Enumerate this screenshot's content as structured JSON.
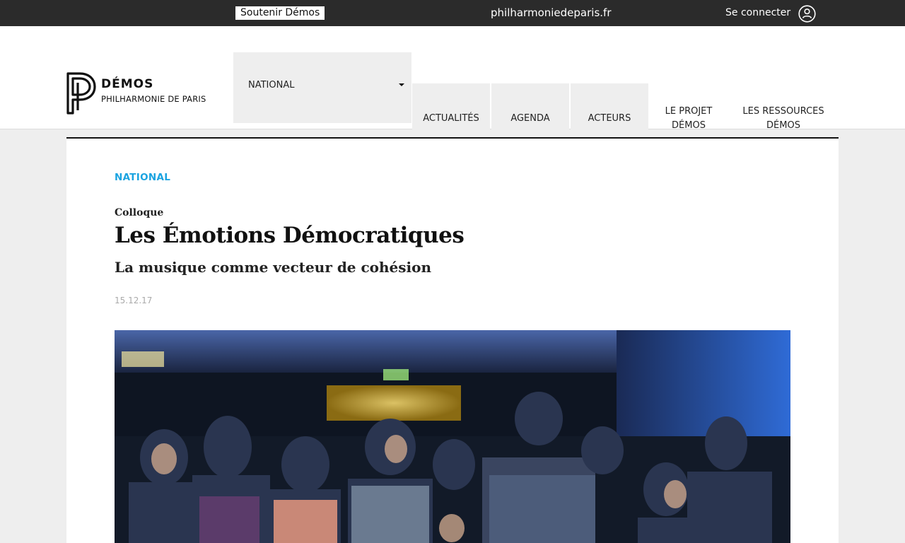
{
  "topbar": {
    "support_label": "Soutenir Démos",
    "site_link": "philharmoniedeparis.fr",
    "login_label": "Se connecter",
    "user_icon": "user-icon"
  },
  "logo": {
    "title": "DÉMOS",
    "subtitle": "PHILHARMONIE DE PARIS"
  },
  "nav": {
    "national": "NATIONAL",
    "items": [
      "ACTUALITÉS",
      "AGENDA",
      "ACTEURS"
    ],
    "projet_line1": "LE PROJET",
    "projet_line2": "DÉMOS",
    "ressources_line1": "LES RESSOURCES",
    "ressources_line2": "DÉMOS"
  },
  "article": {
    "category": "NATIONAL",
    "kicker": "Colloque",
    "title": "Les Émotions Démocratiques",
    "subtitle": "La musique comme vecteur de cohésion",
    "date": "15.12.17"
  },
  "colors": {
    "accent": "#1aa3e0",
    "topbar": "#2b2b2b",
    "nav_bg": "#eeeeee"
  }
}
